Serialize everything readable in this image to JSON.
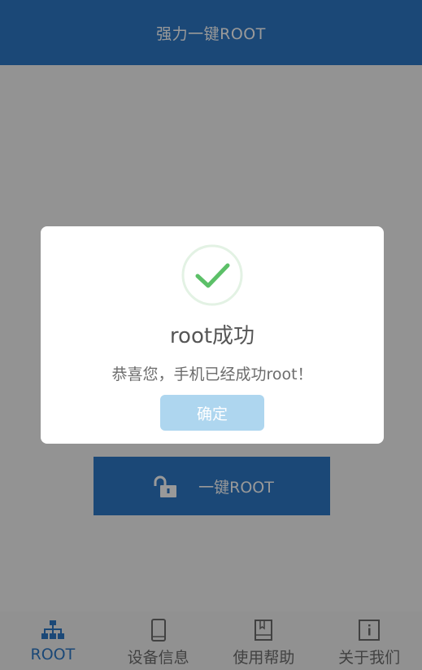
{
  "header": {
    "title": "强力一键ROOT"
  },
  "main": {
    "root_button_label": "一键ROOT"
  },
  "tabbar": {
    "items": [
      {
        "label": "ROOT",
        "icon": "sitemap-icon",
        "active": true
      },
      {
        "label": "设备信息",
        "icon": "phone-icon",
        "active": false
      },
      {
        "label": "使用帮助",
        "icon": "book-icon",
        "active": false
      },
      {
        "label": "关于我们",
        "icon": "info-icon",
        "active": false
      }
    ]
  },
  "dialog": {
    "title": "root成功",
    "message": "恭喜您，手机已经成功root！",
    "confirm_label": "确定",
    "icon": "check-circle-icon"
  },
  "colors": {
    "primary": "#2d79c7",
    "success_check": "#5cc068",
    "confirm_button": "#aed6ef"
  }
}
